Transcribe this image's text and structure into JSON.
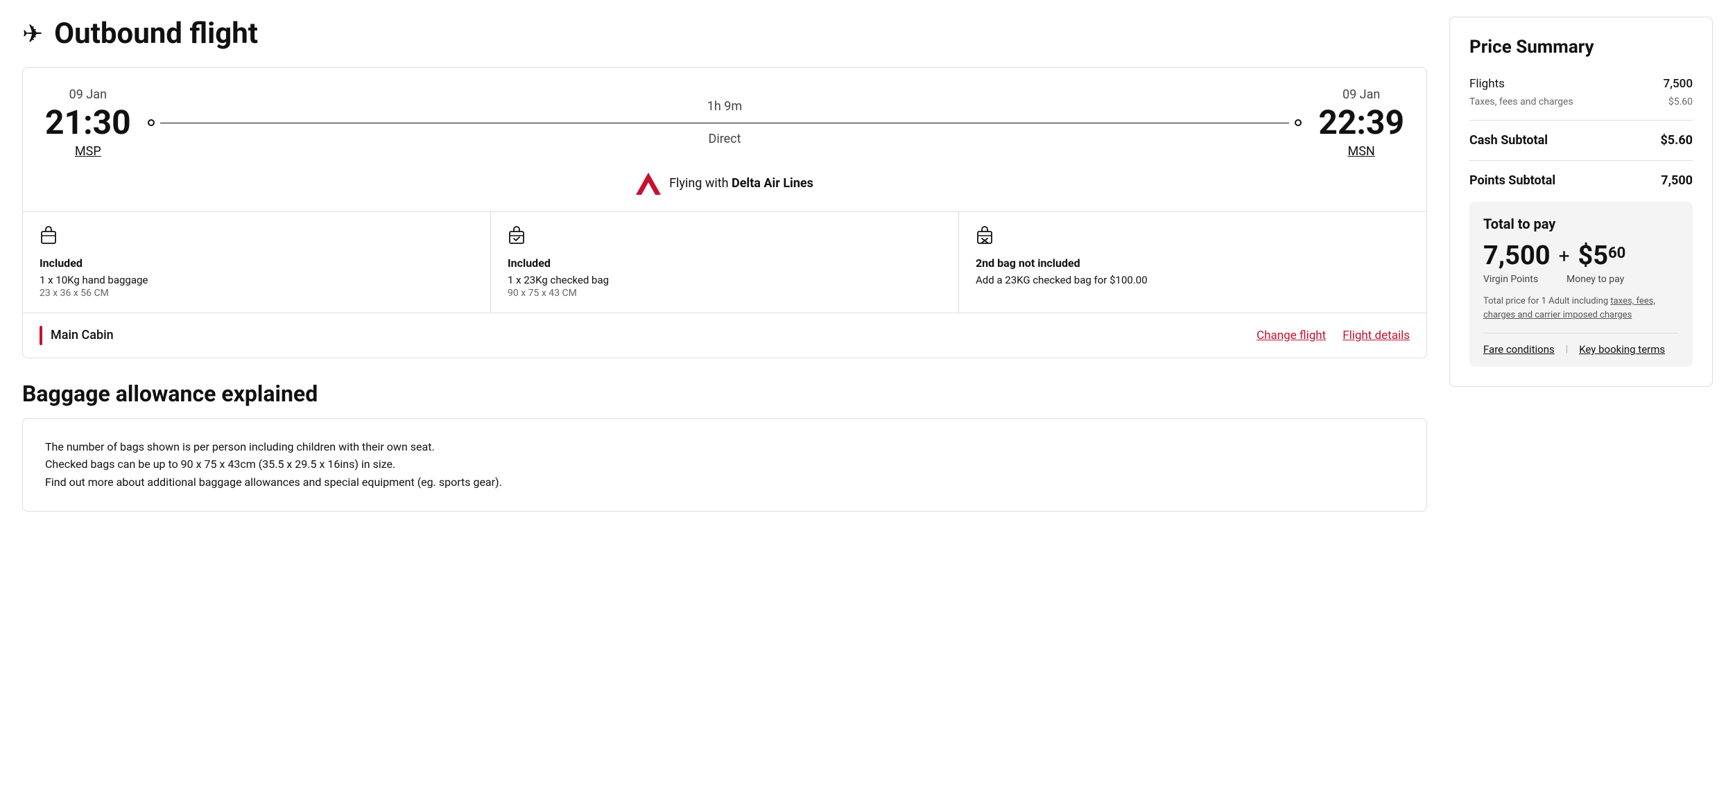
{
  "header": {
    "title": "Outbound flight",
    "icon": "✈"
  },
  "flight": {
    "departure_date": "09 Jan",
    "departure_time": "21:30",
    "departure_airport": "MSP",
    "arrival_date": "09 Jan",
    "arrival_time": "22:39",
    "arrival_airport": "MSN",
    "duration": "1h 9m",
    "stop_type": "Direct",
    "airline_prefix": "Flying with ",
    "airline_name": "Delta Air Lines"
  },
  "baggage": [
    {
      "icon": "🧳",
      "title": "Included",
      "desc": "1 x 10Kg hand baggage",
      "size": "23 x 36 x 56 CM"
    },
    {
      "icon": "✅",
      "title": "Included",
      "desc": "1 x 23Kg checked bag",
      "size": "90 x 75 x 43 CM"
    },
    {
      "icon": "❌",
      "title": "2nd bag not included",
      "desc": "Add a 23KG checked bag for $100.00",
      "size": ""
    }
  ],
  "cabin": {
    "label": "Main Cabin",
    "change_flight": "Change flight",
    "flight_details": "Flight details"
  },
  "baggage_allowance": {
    "title": "Baggage allowance explained",
    "lines": [
      "The number of bags shown is per person including children with their own seat.",
      "Checked bags can be up to 90 x 75 x 43cm (35.5 x 29.5 x 16ins) in size.",
      "Find out more about additional baggage allowances and special equipment (eg. sports gear)."
    ]
  },
  "price_summary": {
    "title": "Price Summary",
    "flights_label": "Flights",
    "flights_value": "7,500",
    "taxes_label": "Taxes, fees and charges",
    "taxes_value": "$5.60",
    "cash_subtotal_label": "Cash Subtotal",
    "cash_subtotal_value": "$5.60",
    "points_subtotal_label": "Points Subtotal",
    "points_subtotal_value": "7,500",
    "total_section": {
      "label": "Total to pay",
      "points": "7,500",
      "plus": "+",
      "cash_main": "$5",
      "cash_sup": "60",
      "points_label": "Virgin Points",
      "cash_label": "Money to pay"
    },
    "footnote": "Total price for 1 Adult including taxes, fees, charges and carrier imposed charges",
    "footnote_link": "taxes, fees, charges and carrier imposed charges",
    "fare_conditions": "Fare conditions",
    "key_booking_terms": "Key booking terms"
  }
}
